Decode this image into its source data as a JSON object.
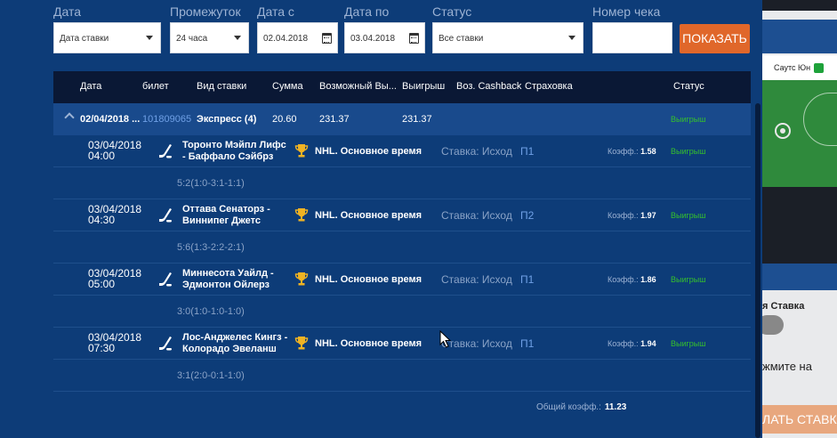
{
  "filters": {
    "date_label": "Дата",
    "date_value": "Дата ставки",
    "period_label": "Промежуток",
    "period_value": "24 часа",
    "date_from_label": "Дата с",
    "date_from_value": "02.04.2018",
    "date_to_label": "Дата по",
    "date_to_value": "03.04.2018",
    "status_label": "Статус",
    "status_value": "Все ставки",
    "check_label": "Номер чека",
    "check_value": "",
    "show_button": "ПОКАЗАТЬ"
  },
  "table": {
    "columns": [
      "Дата",
      "билет",
      "Вид ставки",
      "Сумма",
      "Возможный Вы...",
      "Выигрыш",
      "Воз. Cashback",
      "Страховка",
      "Статус"
    ],
    "summary": {
      "date": "02/04/2018 ...",
      "ticket": "101809065",
      "bet_kind": "Экспресс (4)",
      "sum": "20.60",
      "possible_win": "231.37",
      "win": "231.37",
      "status": "Выигрыш"
    },
    "events": [
      {
        "date": "03/04/2018",
        "time": "04:00",
        "team1": "Торонто Мэйпл Лифс",
        "team2": "- Баффало Сэйбрз",
        "league": "NHL. Основное время",
        "bet_type": "Ставка: Исход",
        "pick": "П1",
        "coef_label": "Коэфф.:",
        "coef": "1.58",
        "status": "Выигрыш",
        "score": "5:2(1:0-3:1-1:1)"
      },
      {
        "date": "03/04/2018",
        "time": "04:30",
        "team1": "Оттава Сенаторз -",
        "team2": "Виннипег Джетс",
        "league": "NHL. Основное время",
        "bet_type": "Ставка: Исход",
        "pick": "П2",
        "coef_label": "Коэфф.:",
        "coef": "1.97",
        "status": "Выигрыш",
        "score": "5:6(1:3-2:2-2:1)"
      },
      {
        "date": "03/04/2018",
        "time": "05:00",
        "team1": "Миннесота Уайлд -",
        "team2": "Эдмонтон Ойлерз",
        "league": "NHL. Основное время",
        "bet_type": "Ставка: Исход",
        "pick": "П1",
        "coef_label": "Коэфф.:",
        "coef": "1.86",
        "status": "Выигрыш",
        "score": "3:0(1:0-1:0-1:0)"
      },
      {
        "date": "03/04/2018",
        "time": "07:30",
        "team1": "Лос-Анджелес Кингз -",
        "team2": "Колорадо Эвеланш",
        "league": "NHL. Основное время",
        "bet_type": "Ставка: Исход",
        "pick": "П1",
        "coef_label": "Коэфф.:",
        "coef": "1.94",
        "status": "Выигрыш",
        "score": "3:1(2:0-0:1-1:0)"
      }
    ],
    "total_label": "Общий коэфф.:",
    "total_value": "11.23"
  },
  "background": {
    "team_name": "Саутс Юн",
    "fast_bet": "я Ставка",
    "press_text": "жмите на",
    "place_bet": "ЛАТЬ СТАВКУ"
  },
  "icons": {
    "sport": "hockey-stick-icon",
    "league": "trophy-icon"
  },
  "colors": {
    "background": "#0d3c78",
    "header": "#0a1835",
    "summary_row": "#194a8c",
    "accent_button": "#e0672a",
    "win_status": "#35c02c",
    "pick": "#6fa0e6"
  }
}
